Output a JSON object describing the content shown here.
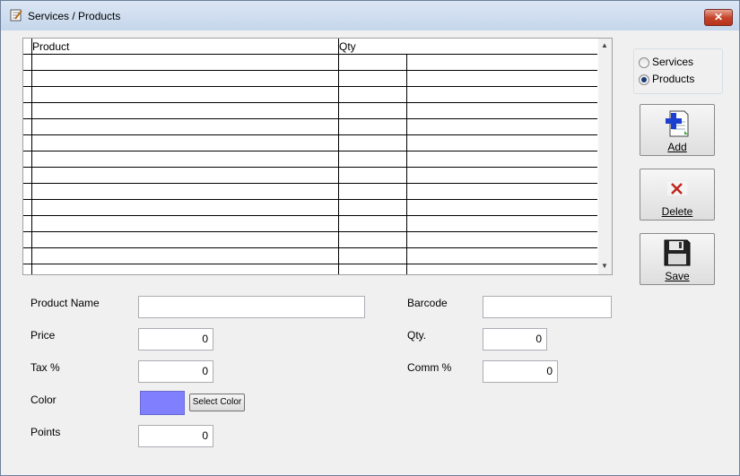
{
  "window": {
    "title": "Services / Products",
    "close_label": "✕"
  },
  "grid": {
    "columns": [
      "Product",
      "Qty"
    ],
    "rows": 13
  },
  "mode": {
    "options": [
      "Services",
      "Products"
    ],
    "selected": "Products"
  },
  "buttons": {
    "add": "Add",
    "delete": "Delete",
    "save": "Save"
  },
  "form": {
    "product_name_label": "Product Name",
    "product_name_value": "",
    "price_label": "Price",
    "price_value": "0",
    "tax_label": "Tax %",
    "tax_value": "0",
    "color_label": "Color",
    "color_value": "#8080ff",
    "select_color_label": "Select Color",
    "points_label": "Points",
    "points_value": "0",
    "barcode_label": "Barcode",
    "barcode_value": "",
    "qty_label": "Qty.",
    "qty_value": "0",
    "comm_label": "Comm %",
    "comm_value": "0"
  },
  "icons": {
    "window": "notepad-icon",
    "add": "add-document-icon",
    "delete": "delete-x-icon",
    "save": "floppy-disk-icon"
  }
}
